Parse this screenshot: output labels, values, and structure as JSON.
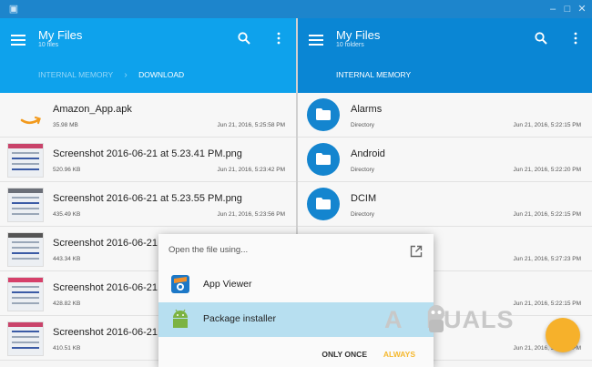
{
  "left_pane": {
    "title": "My Files",
    "subtitle": "10 files",
    "breadcrumb": [
      "INTERNAL MEMORY",
      "DOWNLOAD"
    ],
    "files": [
      {
        "name": "Amazon_App.apk",
        "size": "35.98 MB",
        "date": "Jun 21, 2016, 5:25:58 PM",
        "thumb": "amazon-icon"
      },
      {
        "name": "Screenshot 2016-06-21 at 5.23.41 PM.png",
        "size": "520.96 KB",
        "date": "Jun 21, 2016, 5:23:42 PM",
        "thumb": "screenshot"
      },
      {
        "name": "Screenshot 2016-06-21 at 5.23.55 PM.png",
        "size": "435.49 KB",
        "date": "Jun 21, 2016, 5:23:56 PM",
        "thumb": "screenshot"
      },
      {
        "name": "Screenshot 2016-06-21",
        "size": "443.34 KB",
        "date": "",
        "thumb": "screenshot"
      },
      {
        "name": "Screenshot 2016-06-21",
        "size": "428.82 KB",
        "date": "",
        "thumb": "screenshot"
      },
      {
        "name": "Screenshot 2016-06-21",
        "size": "410.51 KB",
        "date": "",
        "thumb": "screenshot"
      }
    ]
  },
  "right_pane": {
    "title": "My Files",
    "subtitle": "10 folders",
    "breadcrumb": "INTERNAL MEMORY",
    "folders": [
      {
        "name": "Alarms",
        "type": "Directory",
        "date": "Jun 21, 2016, 5:22:15 PM"
      },
      {
        "name": "Android",
        "type": "Directory",
        "date": "Jun 21, 2016, 5:22:20 PM"
      },
      {
        "name": "DCIM",
        "type": "Directory",
        "date": "Jun 21, 2016, 5:22:15 PM"
      },
      {
        "name": "",
        "type": "",
        "date": "Jun 21, 2016, 5:27:23 PM"
      },
      {
        "name": "",
        "type": "",
        "date": "Jun 21, 2016, 5:22:15 PM"
      },
      {
        "name": "",
        "type": "",
        "date": "Jun 21, 2016, 5:22:15 PM"
      }
    ]
  },
  "dialog": {
    "title": "Open the file using...",
    "apps": [
      {
        "label": "App Viewer",
        "icon": "app-viewer-icon"
      },
      {
        "label": "Package installer",
        "icon": "android-icon",
        "selected": true
      }
    ],
    "only_once": "ONLY ONCE",
    "always": "ALWAYS"
  },
  "watermark": "APPUALS",
  "colors": {
    "left_bar": "#0ea2ec",
    "right_bar": "#0a86d4",
    "folder": "#1485cf",
    "accent": "#f6b12b",
    "selected": "#b7dff0"
  }
}
